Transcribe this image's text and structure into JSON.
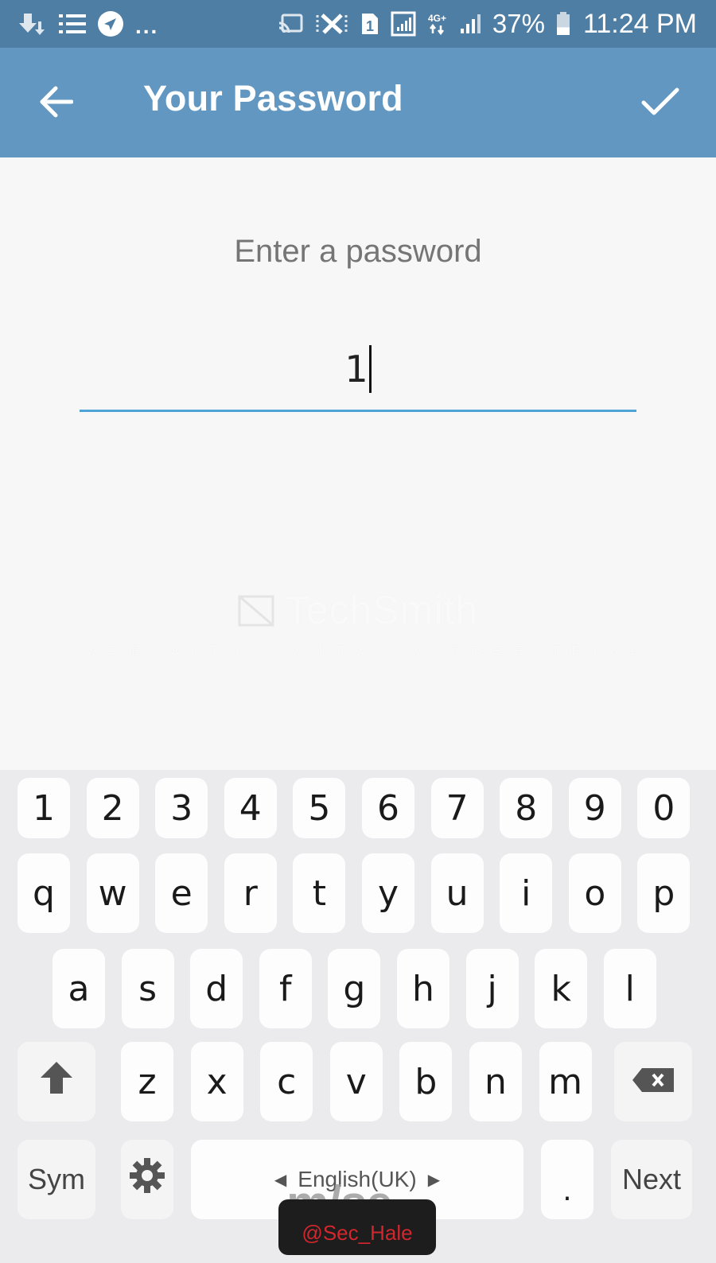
{
  "status_bar": {
    "left_icons": [
      "download-notification-icon",
      "list-notification-icon",
      "telegram-icon"
    ],
    "more": "...",
    "right_icons": [
      "cast-icon",
      "vibrate-mute-icon",
      "sim-1-icon",
      "signal-box-icon",
      "4g-plus-icon",
      "signal-bars-icon"
    ],
    "sim_label": "1",
    "network": "4G+",
    "battery": "37%",
    "battery_level_percent": 37,
    "time": "11:24 PM"
  },
  "app_bar": {
    "title": "Your Password",
    "back_icon": "arrow-left-icon",
    "done_icon": "checkmark-icon",
    "color": "#6197c1"
  },
  "form": {
    "prompt": "Enter a password",
    "password_value": "1",
    "underline_color": "#4ea4d6"
  },
  "watermark": {
    "logo": "TechSmith",
    "subtitle": "MADE WITH CAMTASIA FREE TRIAL"
  },
  "keyboard": {
    "row_numbers": [
      "1",
      "2",
      "3",
      "4",
      "5",
      "6",
      "7",
      "8",
      "9",
      "0"
    ],
    "row_1": [
      "q",
      "w",
      "e",
      "r",
      "t",
      "y",
      "u",
      "i",
      "o",
      "p"
    ],
    "row_2": [
      "a",
      "s",
      "d",
      "f",
      "g",
      "h",
      "j",
      "k",
      "l"
    ],
    "row_3": [
      "z",
      "x",
      "c",
      "v",
      "b",
      "n",
      "m"
    ],
    "shift_icon": "shift-arrow-icon",
    "backspace_icon": "backspace-icon",
    "sym_label": "Sym",
    "settings_icon": "gear-icon",
    "space_label": "English(UK)",
    "period_label": ".",
    "next_label": "Next"
  },
  "overlay": {
    "big_text": "m/se",
    "handle": "@Sec_Hale"
  }
}
